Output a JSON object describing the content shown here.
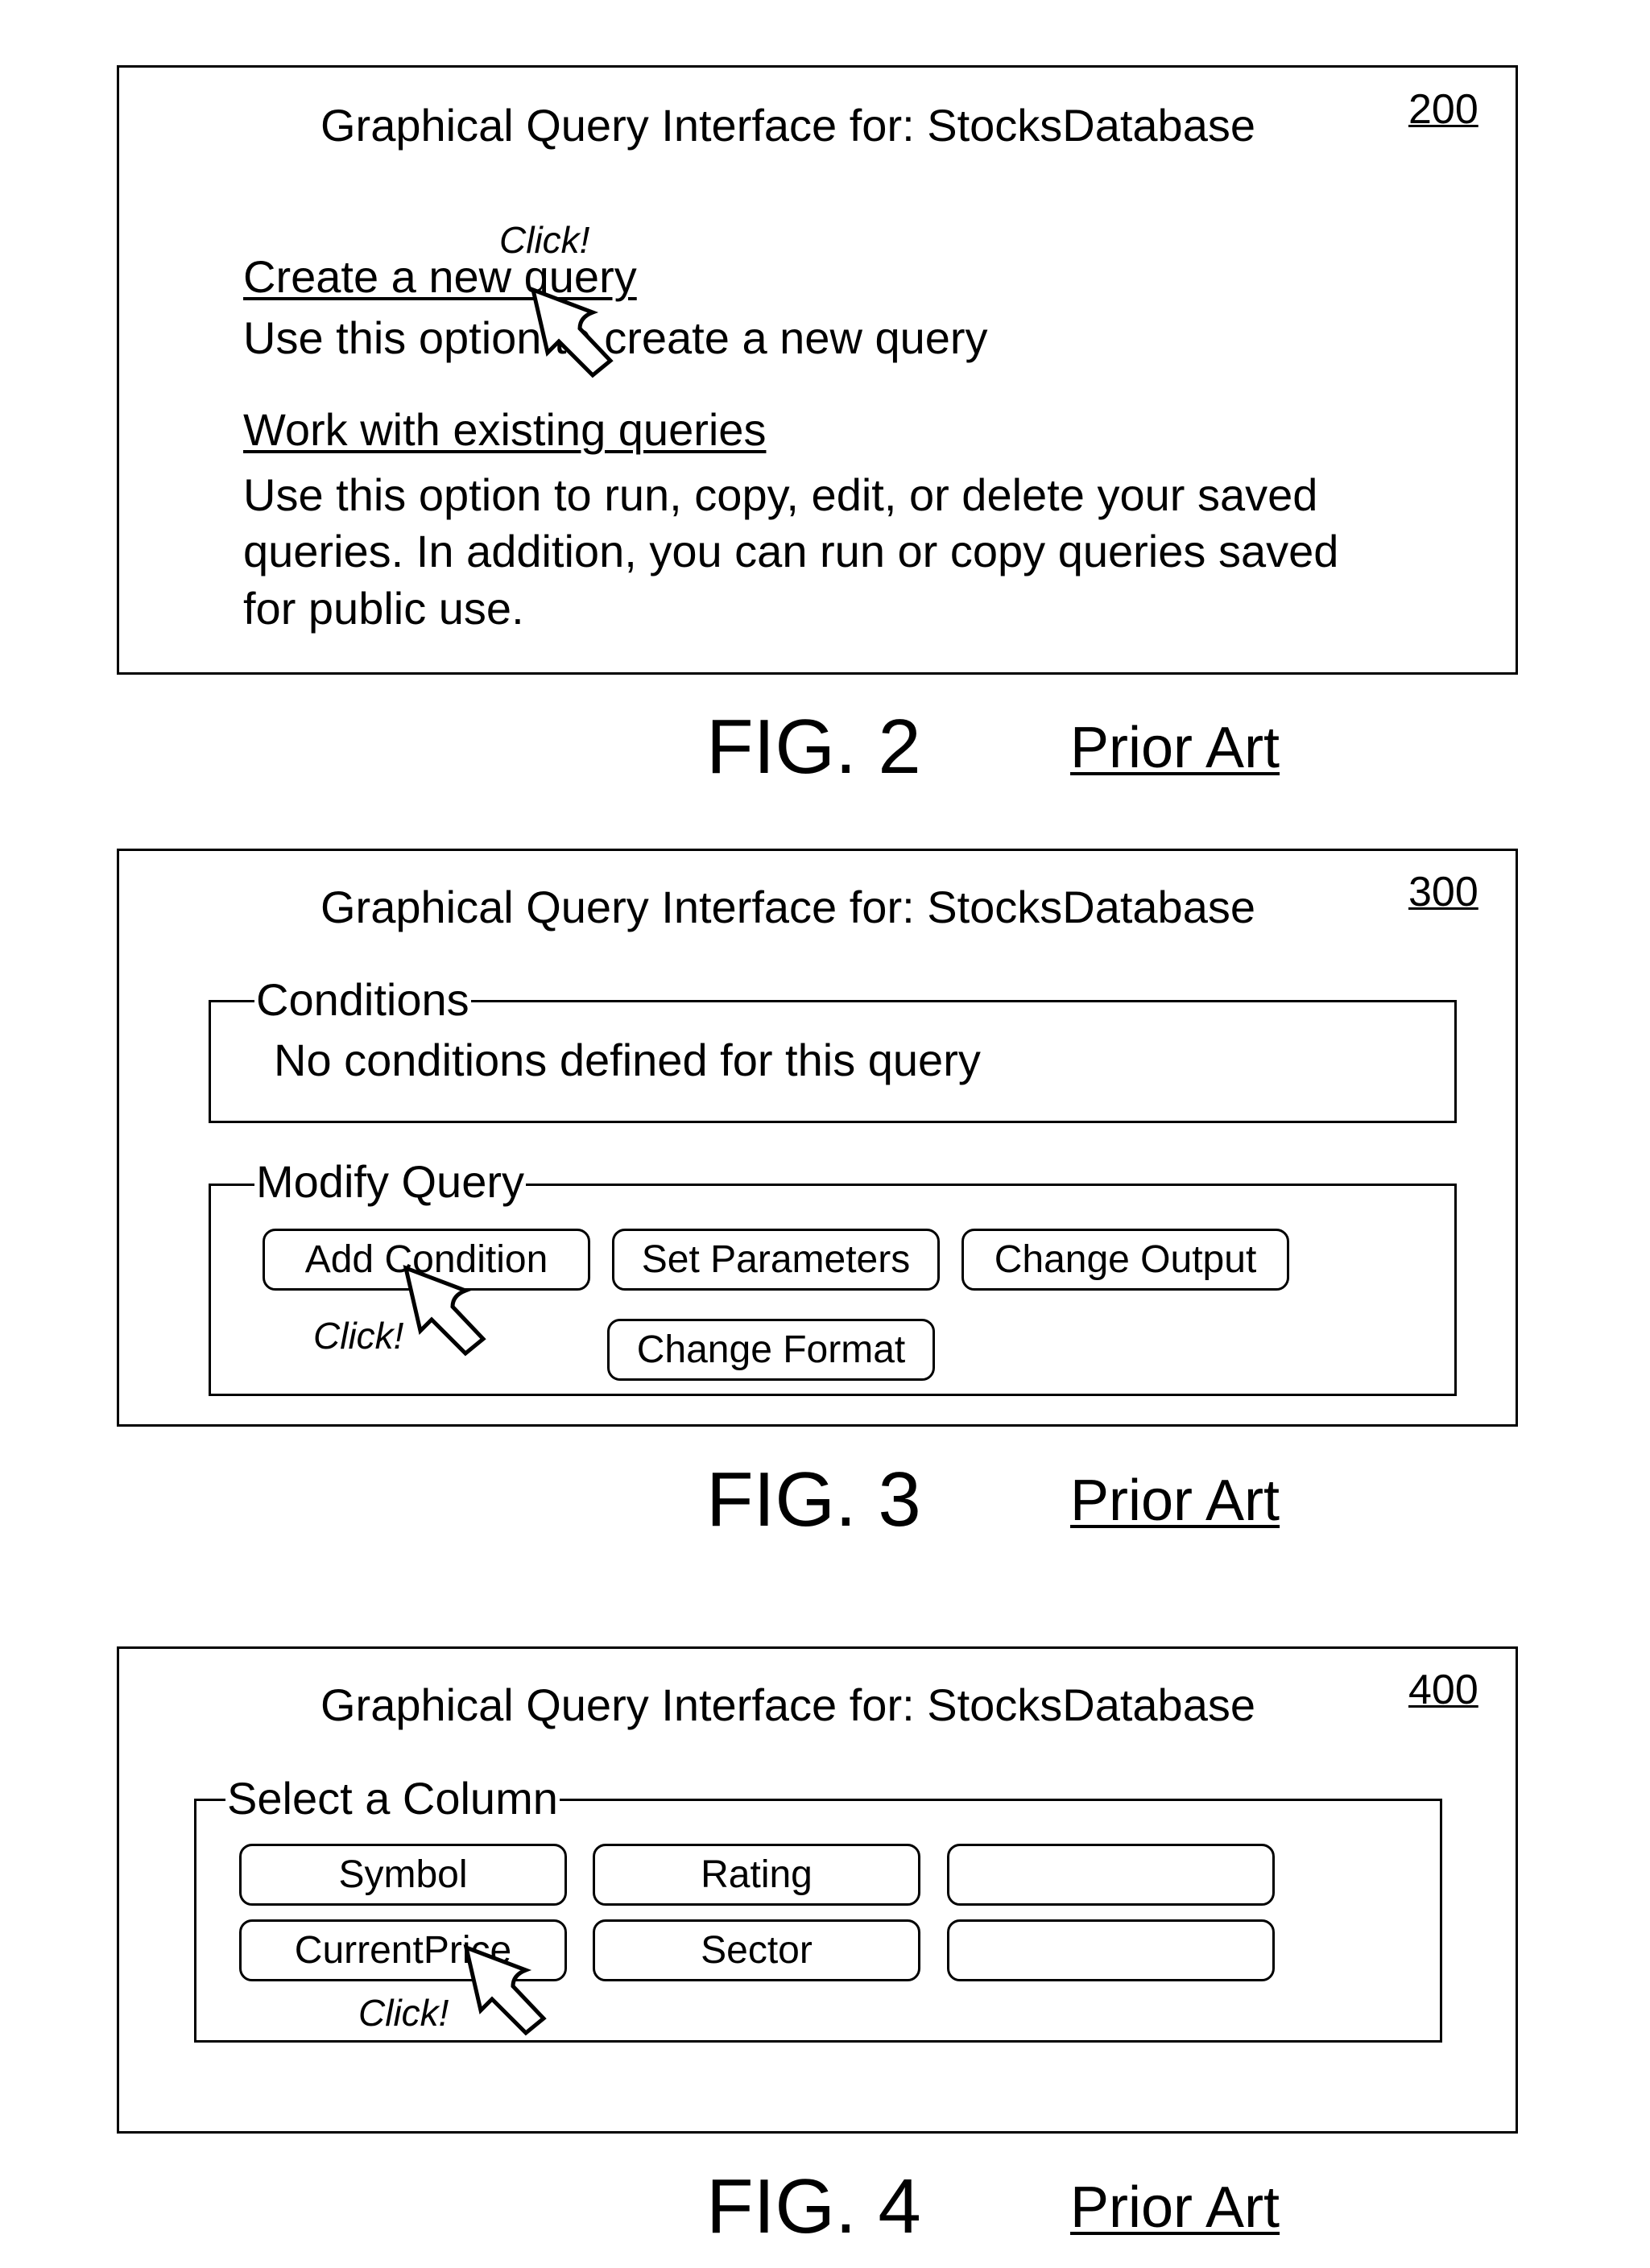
{
  "figures": {
    "fig2": {
      "title": "Graphical Query Interface for:  StocksDatabase",
      "ref": "200",
      "click_label": "Click!",
      "create_link": "Create a new query",
      "create_desc": "Use this option to create a new query",
      "existing_link": "Work with existing queries",
      "existing_desc": [
        "Use this option to run, copy, edit, or delete your saved",
        "queries.  In addition, you can run or copy queries saved",
        "for public use."
      ],
      "fig_label": "FIG. 2",
      "prior_art": "Prior Art"
    },
    "fig3": {
      "title": "Graphical Query Interface for:  StocksDatabase",
      "ref": "300",
      "conditions_legend": "Conditions",
      "conditions_text": "No conditions defined for this query",
      "modify_legend": "Modify Query",
      "buttons": {
        "add_condition": "Add Condition",
        "set_parameters": "Set Parameters",
        "change_output": "Change Output",
        "change_format": "Change Format"
      },
      "click_label": "Click!",
      "fig_label": "FIG. 3",
      "prior_art": "Prior Art"
    },
    "fig4": {
      "title": "Graphical Query Interface for:  StocksDatabase",
      "ref": "400",
      "select_legend": "Select a Column",
      "columns": [
        "Symbol",
        "Rating",
        "",
        "CurrentPrice",
        "Sector",
        ""
      ],
      "click_label": "Click!",
      "fig_label": "FIG. 4",
      "prior_art": "Prior Art"
    }
  },
  "icons": {
    "cursor": "mouse-pointer-arrow-icon"
  }
}
